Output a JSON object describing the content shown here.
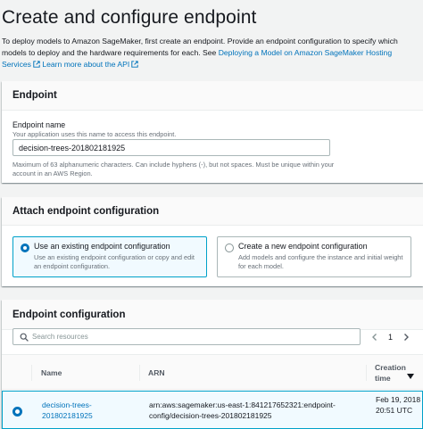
{
  "page": {
    "title": "Create and configure endpoint",
    "intro_text": "To deploy models to Amazon SageMaker, first create an endpoint. Provide an endpoint configuration to specify which models to deploy and the hardware requirements for each. See ",
    "intro_link1": "Deploying a Model on Amazon SageMaker Hosting Services",
    "intro_link2": "Learn more about the API"
  },
  "endpoint_panel": {
    "title": "Endpoint",
    "name_label": "Endpoint name",
    "name_description": "Your application uses this name to access this endpoint.",
    "name_value": "decision-trees-201802181925",
    "name_constraint": "Maximum of 63 alphanumeric characters. Can include hyphens (-), but not spaces. Must be unique within your account in an AWS Region."
  },
  "attach_panel": {
    "title": "Attach endpoint configuration",
    "options": [
      {
        "title": "Use an existing endpoint configuration",
        "description": "Use an existing endpoint configuration or copy and edit an endpoint configuration.",
        "selected": true
      },
      {
        "title": "Create a new endpoint configuration",
        "description": "Add models and configure the instance and initial weight for each model.",
        "selected": false
      }
    ]
  },
  "config_panel": {
    "title": "Endpoint configuration",
    "search_placeholder": "Search resources",
    "page_number": "1",
    "columns": {
      "name": "Name",
      "arn": "ARN",
      "creation_time": "Creation time"
    },
    "rows": [
      {
        "name": "decision-trees-201802181925",
        "arn": "arn:aws:sagemaker:us-east-1:841217652321:endpoint-config/decision-trees-201802181925",
        "creation_time": "Feb 19, 2018 20:51 UTC",
        "selected": true
      }
    ]
  },
  "colors": {
    "link": "#0073bb",
    "selected_border": "#00a1c9",
    "selected_background": "#f1faff",
    "page_background": "#f2f3f3"
  },
  "icons": {
    "external_link": "external-link-icon",
    "search": "search-icon",
    "previous": "chevron-left-icon",
    "next": "chevron-right-icon",
    "sort": "caret-down-icon"
  }
}
